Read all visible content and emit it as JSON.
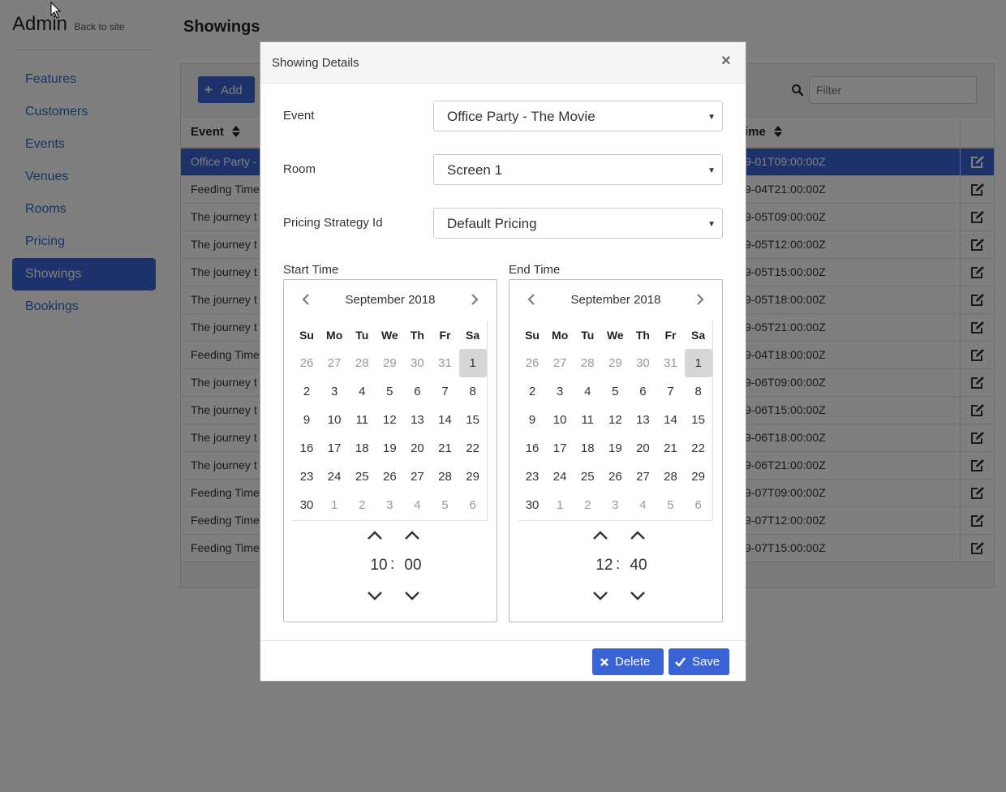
{
  "brand": {
    "title": "Admin",
    "back_link": "Back to site"
  },
  "sidebar": {
    "items": [
      {
        "label": "Features",
        "active": false
      },
      {
        "label": "Customers",
        "active": false
      },
      {
        "label": "Events",
        "active": false
      },
      {
        "label": "Venues",
        "active": false
      },
      {
        "label": "Rooms",
        "active": false
      },
      {
        "label": "Pricing",
        "active": false
      },
      {
        "label": "Showings",
        "active": true
      },
      {
        "label": "Bookings",
        "active": false
      }
    ]
  },
  "page": {
    "title": "Showings"
  },
  "toolbar": {
    "add_label": "Add",
    "filter_placeholder": "Filter"
  },
  "table": {
    "columns": [
      "Event",
      "ime"
    ],
    "rows": [
      {
        "event": "Office Party -",
        "time": "9-01T09:00:00Z",
        "selected": true
      },
      {
        "event": "Feeding Time",
        "time": "9-04T21:00:00Z"
      },
      {
        "event": "The journey t",
        "time": "9-05T09:00:00Z"
      },
      {
        "event": "The journey t",
        "time": "9-05T12:00:00Z"
      },
      {
        "event": "The journey t",
        "time": "9-05T15:00:00Z"
      },
      {
        "event": "The journey t",
        "time": "9-05T18:00:00Z"
      },
      {
        "event": "The journey t",
        "time": "9-05T21:00:00Z"
      },
      {
        "event": "Feeding Time",
        "time": "9-04T18:00:00Z"
      },
      {
        "event": "The journey t",
        "time": "9-06T09:00:00Z"
      },
      {
        "event": "The journey t",
        "time": "9-06T15:00:00Z"
      },
      {
        "event": "The journey t",
        "time": "9-06T18:00:00Z"
      },
      {
        "event": "The journey t",
        "time": "9-06T21:00:00Z"
      },
      {
        "event": "Feeding Time",
        "time": "9-07T09:00:00Z"
      },
      {
        "event": "Feeding Time",
        "time": "9-07T12:00:00Z"
      },
      {
        "event": "Feeding Time",
        "time": "9-07T15:00:00Z"
      }
    ]
  },
  "modal": {
    "title": "Showing Details",
    "close": "×",
    "fields": {
      "event": {
        "label": "Event",
        "value": "Office Party - The Movie"
      },
      "room": {
        "label": "Room",
        "value": "Screen 1"
      },
      "pricing": {
        "label": "Pricing Strategy Id",
        "value": "Default Pricing"
      }
    },
    "start": {
      "label": "Start Time",
      "month": "September 2018",
      "hour": "10",
      "minute": "00"
    },
    "end": {
      "label": "End Time",
      "month": "September 2018",
      "hour": "12",
      "minute": "40"
    },
    "calendar": {
      "dow": [
        "Su",
        "Mo",
        "Tu",
        "We",
        "Th",
        "Fr",
        "Sa"
      ],
      "weeks": [
        [
          "26",
          "27",
          "28",
          "29",
          "30",
          "31",
          "1"
        ],
        [
          "2",
          "3",
          "4",
          "5",
          "6",
          "7",
          "8"
        ],
        [
          "9",
          "10",
          "11",
          "12",
          "13",
          "14",
          "15"
        ],
        [
          "16",
          "17",
          "18",
          "19",
          "20",
          "21",
          "22"
        ],
        [
          "23",
          "24",
          "25",
          "26",
          "27",
          "28",
          "29"
        ],
        [
          "30",
          "1",
          "2",
          "3",
          "4",
          "5",
          "6"
        ]
      ],
      "selected_day": "1"
    },
    "time_separator": ":",
    "delete_label": "Delete",
    "save_label": "Save"
  },
  "colors": {
    "primary": "#3a63d6",
    "backdrop": "rgba(0,0,0,0.5)"
  }
}
